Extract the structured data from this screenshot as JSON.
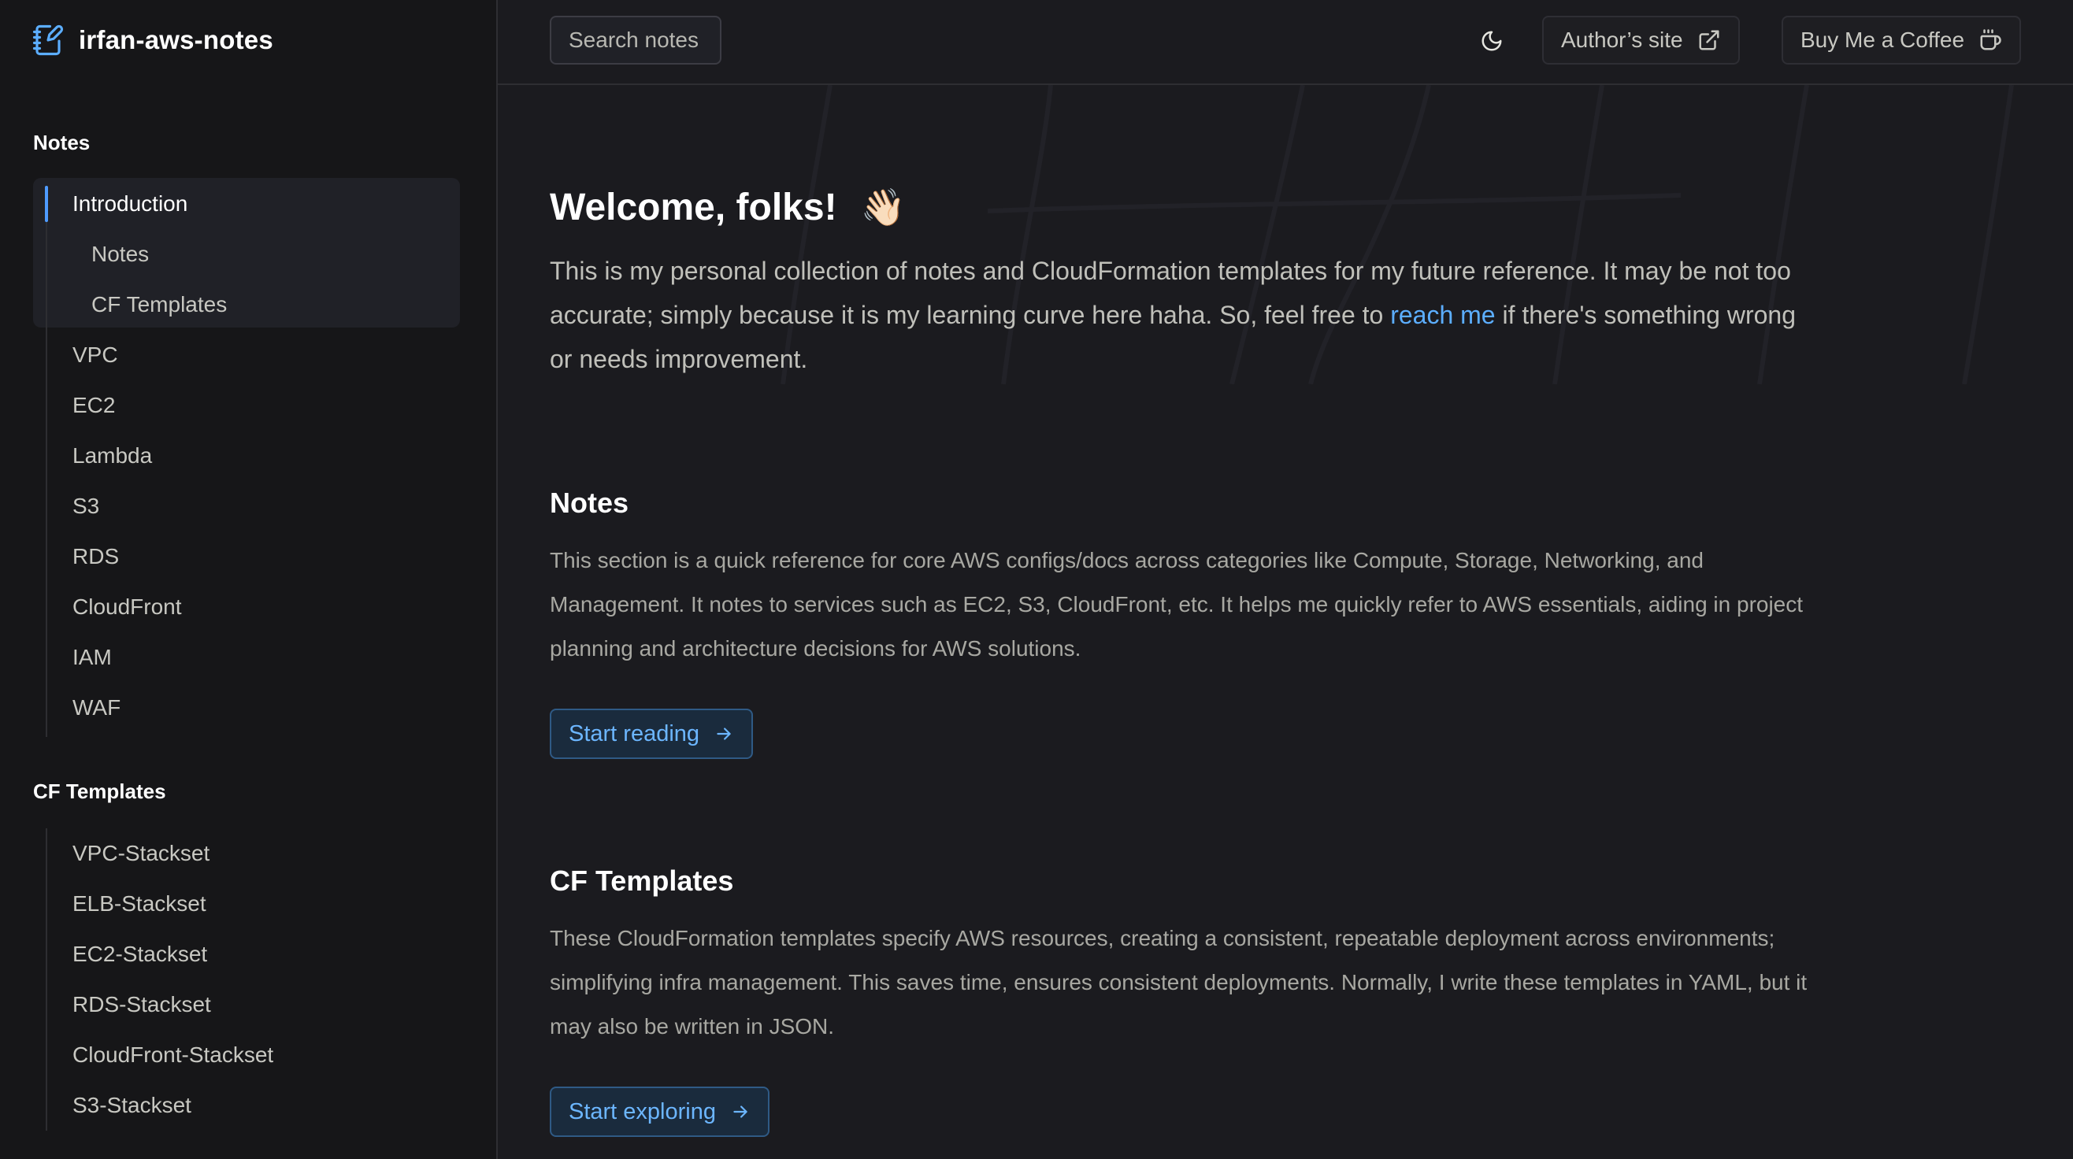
{
  "brand": {
    "title": "irfan-aws-notes",
    "icon": "notebook-pen-icon"
  },
  "sidebar": {
    "groups": [
      {
        "title": "Notes",
        "items": [
          {
            "label": "Introduction",
            "active": true
          },
          {
            "label": "Notes",
            "sub": true
          },
          {
            "label": "CF Templates",
            "sub": true
          },
          {
            "label": "VPC"
          },
          {
            "label": "EC2"
          },
          {
            "label": "Lambda"
          },
          {
            "label": "S3"
          },
          {
            "label": "RDS"
          },
          {
            "label": "CloudFront"
          },
          {
            "label": "IAM"
          },
          {
            "label": "WAF"
          }
        ]
      },
      {
        "title": "CF Templates",
        "items": [
          {
            "label": "VPC-Stackset"
          },
          {
            "label": "ELB-Stackset"
          },
          {
            "label": "EC2-Stackset"
          },
          {
            "label": "RDS-Stackset"
          },
          {
            "label": "CloudFront-Stackset"
          },
          {
            "label": "S3-Stackset"
          }
        ]
      }
    ]
  },
  "topbar": {
    "search_placeholder": "Search notes",
    "theme_icon": "moon-icon",
    "author_label": "Author’s site",
    "author_icon": "external-link-icon",
    "coffee_label": "Buy Me a Coffee",
    "coffee_icon": "coffee-cup-icon"
  },
  "main": {
    "title": "Welcome, folks!",
    "title_emoji": "👋🏻",
    "lead_before": "This is my personal collection of notes and CloudFormation templates for my future reference. It may be not too accurate; simply because it is my learning curve here haha. So, feel free to ",
    "lead_link": "reach me",
    "lead_after": " if there's something wrong or needs improvement.",
    "sections": [
      {
        "title": "Notes",
        "text": "This section is a quick reference for core AWS configs/docs across categories like Compute, Storage, Networking, and Management. It notes to services such as EC2, S3, CloudFront, etc. It helps me quickly refer to AWS essentials, aiding in project planning and architecture decisions for AWS solutions.",
        "button": "Start reading"
      },
      {
        "title": "CF Templates",
        "text": "These CloudFormation templates specify AWS resources, creating a consistent, repeatable deployment across environments; simplifying infra management. This saves time, ensures consistent deployments. Normally, I write these templates in YAML, but it may also be written in JSON.",
        "button": "Start exploring"
      }
    ]
  },
  "colors": {
    "accent": "#5caeff",
    "background": "#1b1b1f",
    "sidebar": "#161618"
  }
}
